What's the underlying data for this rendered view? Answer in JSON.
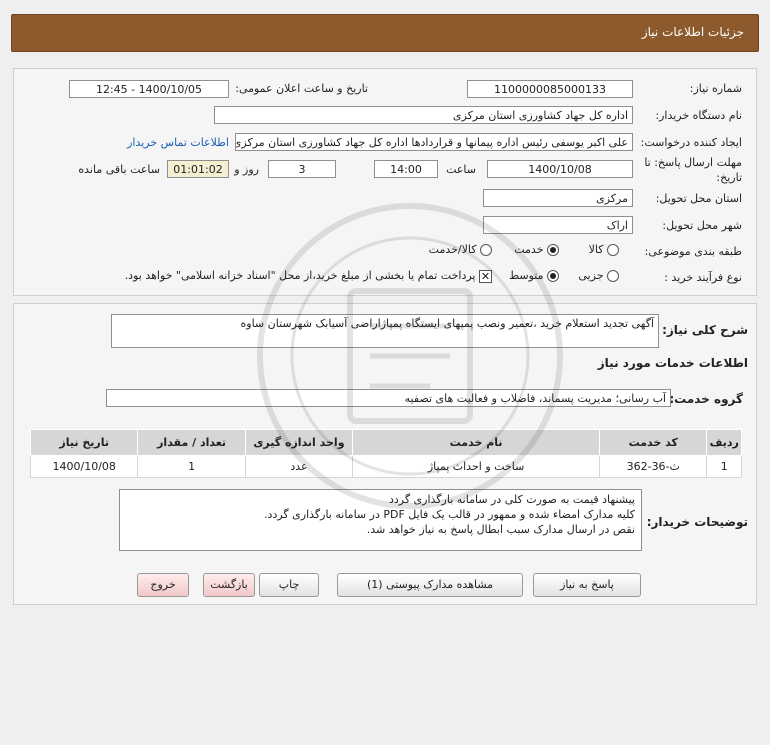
{
  "header": {
    "title": "جزئیات اطلاعات نیاز"
  },
  "info": {
    "need_number_label": "شماره نیاز:",
    "need_number": "1100000085000133",
    "announce_label": "تاریخ و ساعت اعلان عمومی:",
    "announce_value": "1400/10/05 - 12:45",
    "buyer_org_label": "نام دستگاه خریدار:",
    "buyer_org": "اداره کل جهاد کشاورزی استان مرکزی",
    "creator_label": "ایجاد کننده درخواست:",
    "creator": "علی اکبر یوسفی رئیس اداره پیمانها و قراردادها اداره کل جهاد کشاورزی استان مرکزی",
    "contact_link": "اطلاعات تماس خریدار",
    "deadline_label_line1": "مهلت ارسال پاسخ: تا",
    "deadline_label_line2": "تاریخ:",
    "deadline_date": "1400/10/08",
    "time_label": "ساعت",
    "deadline_time": "14:00",
    "days_value": "3",
    "days_label": "روز و",
    "remaining_value": "01:01:02",
    "remaining_label": "ساعت باقی مانده",
    "province_label": "استان محل تحویل:",
    "province": "مرکزی",
    "city_label": "شهر محل تحویل:",
    "city": "اراک",
    "category_label": "طبقه بندی موضوعی:",
    "category_options": [
      "کالا",
      "خدمت",
      "کالا/خدمت"
    ],
    "category_selected": "خدمت",
    "process_label": "نوع فرآیند خرید :",
    "process_options": [
      "جزیی",
      "متوسط"
    ],
    "process_selected": "متوسط",
    "payment_note": "پرداخت تمام یا بخشی از مبلغ خرید،از محل \"اسناد خزانه اسلامی\" خواهد بود."
  },
  "details": {
    "desc_label": "شرح کلی نیاز:",
    "desc": "آگهی تجدید استعلام خرید ،تعمیر ونصب پمپهای ایستگاه پمپاژاراضی آسیابک شهرستان ساوه",
    "services_title": "اطلاعات خدمات مورد نیاز",
    "group_label": "گروه خدمت:",
    "group_value": "آب رسانی؛ مدیریت پسماند، فاضلاب و فعالیت های تصفیه",
    "table": {
      "headers": [
        "ردیف",
        "کد خدمت",
        "نام خدمت",
        "واحد اندازه گیری",
        "تعداد / مقدار",
        "تاریخ نیاز"
      ],
      "rows": [
        [
          "1",
          "ث-36-362",
          "ساخت و احداث پمپاژ",
          "عدد",
          "1",
          "1400/10/08"
        ]
      ]
    },
    "notes_label": "توضیحات خریدار:",
    "notes": [
      "پیشنهاد قیمت به صورت کلی در سامانه بارگذاری گردد",
      "کلیه مدارک امضاء شده و ممهور در قالب یک فایل PDF  در سامانه بارگذاری گردد.",
      "نقص در ارسال مدارک سبب ابطال پاسخ به نیاز خواهد شد."
    ]
  },
  "buttons": {
    "reply": "پاسخ به نیاز",
    "attachments": "مشاهده مدارک پیوستی (1)",
    "print": "چاپ",
    "back": "بازگشت",
    "exit": "خروج"
  }
}
